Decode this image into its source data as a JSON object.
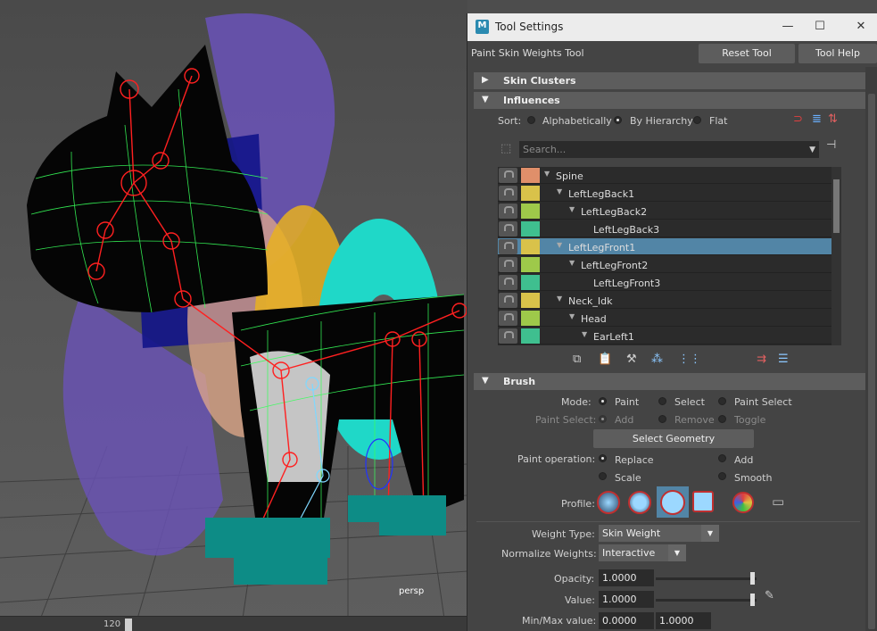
{
  "viewport": {
    "camera_label": "persp",
    "timeline_frame": "120"
  },
  "window": {
    "title": "Tool Settings",
    "app_icon": "M",
    "minimize": "—",
    "maximize": "☐",
    "close": "✕"
  },
  "tool": {
    "name": "Paint Skin Weights Tool",
    "reset_label": "Reset Tool",
    "help_label": "Tool Help"
  },
  "sections": {
    "skin_clusters": "Skin Clusters",
    "influences": "Influences",
    "brush": "Brush"
  },
  "influences": {
    "sort_label": "Sort:",
    "sort_options": [
      "Alphabetically",
      "By Hierarchy",
      "Flat"
    ],
    "sort_selected": "By Hierarchy",
    "search_placeholder": "Search...",
    "rows": [
      {
        "name": "Spine",
        "color": "#e08f6a"
      },
      {
        "name": "LeftLegBack1",
        "color": "#d9c24a"
      },
      {
        "name": "LeftLegBack2",
        "color": "#9ec94a"
      },
      {
        "name": "LeftLegBack3",
        "color": "#3fbf8f"
      },
      {
        "name": "LeftLegFront1",
        "color": "#d9c24a"
      },
      {
        "name": "LeftLegFront2",
        "color": "#9ec94a"
      },
      {
        "name": "LeftLegFront3",
        "color": "#3fbf8f"
      },
      {
        "name": "Neck_Idk",
        "color": "#d9c24a"
      },
      {
        "name": "Head",
        "color": "#9ec94a"
      },
      {
        "name": "EarLeft1",
        "color": "#3fbf8f"
      }
    ],
    "selected_row": "LeftLegFront1"
  },
  "brush": {
    "mode_label": "Mode:",
    "mode_options": [
      "Paint",
      "Select",
      "Paint Select"
    ],
    "mode_selected": "Paint",
    "paint_select_label": "Paint Select:",
    "paint_select_options": [
      "Add",
      "Remove",
      "Toggle"
    ],
    "select_geometry_label": "Select Geometry",
    "paint_operation_label": "Paint operation:",
    "paint_operations": [
      "Replace",
      "Add",
      "Scale",
      "Smooth"
    ],
    "paint_operation_selected": "Replace",
    "profile_label": "Profile:",
    "weight_type_label": "Weight Type:",
    "weight_type_value": "Skin Weight",
    "normalize_label": "Normalize Weights:",
    "normalize_value": "Interactive",
    "opacity_label": "Opacity:",
    "opacity_value": "1.0000",
    "value_label": "Value:",
    "value_value": "1.0000",
    "minmax_label": "Min/Max value:",
    "min_value": "0.0000",
    "max_value": "1.0000"
  }
}
